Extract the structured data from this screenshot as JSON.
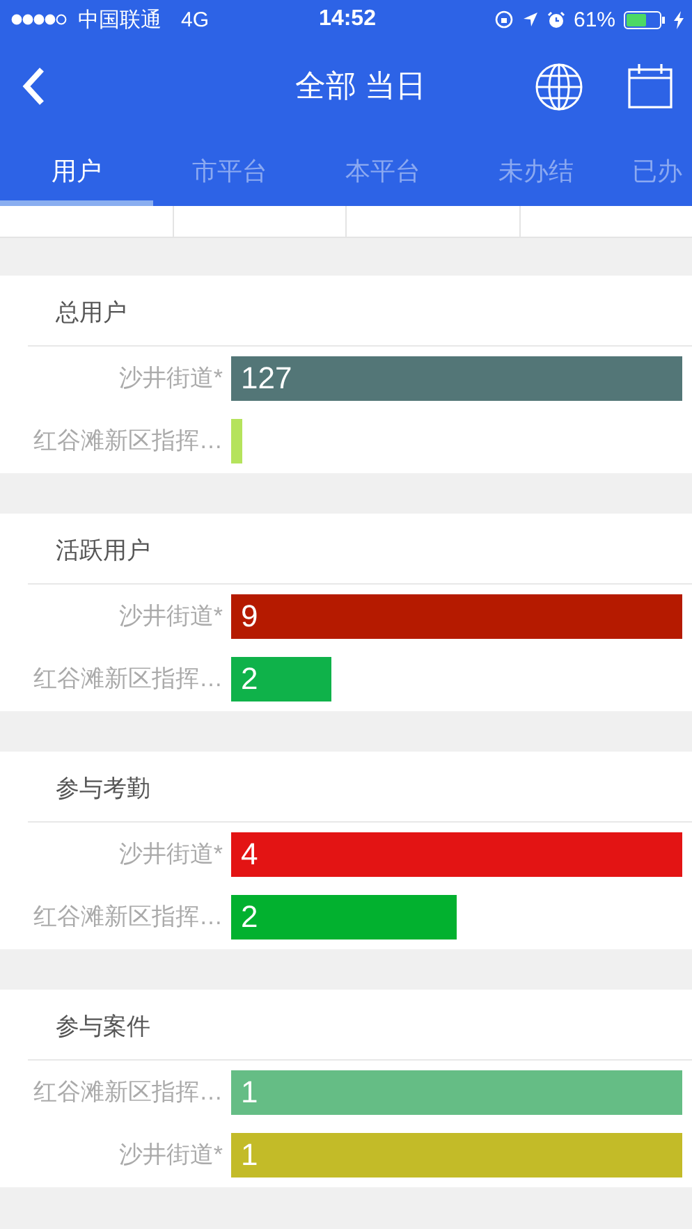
{
  "status_bar": {
    "carrier": "中国联通",
    "network": "4G",
    "time": "14:52",
    "battery": "61%",
    "charging": true
  },
  "header": {
    "title": "全部 当日"
  },
  "tabs": [
    {
      "label": "用户",
      "selected": true
    },
    {
      "label": "市平台",
      "selected": false
    },
    {
      "label": "本平台",
      "selected": false
    },
    {
      "label": "未办结",
      "selected": false
    },
    {
      "label": "已办",
      "selected": false
    }
  ],
  "cards": [
    {
      "title": "总用户",
      "bars": [
        {
          "label": "沙井街道*",
          "value": "127",
          "color": "#537677"
        },
        {
          "label": "红谷滩新区指挥…",
          "color": "#b5e35c"
        }
      ]
    },
    {
      "title": "活跃用户",
      "bars": [
        {
          "label": "沙井街道*",
          "value": "9",
          "color": "#b51a00"
        },
        {
          "label": "红谷滩新区指挥…",
          "value": "2",
          "color": "#0fb24a"
        }
      ]
    },
    {
      "title": "参与考勤",
      "bars": [
        {
          "label": "沙井街道*",
          "value": "4",
          "color": "#e31414"
        },
        {
          "label": "红谷滩新区指挥…",
          "value": "2",
          "color": "#02b12f"
        }
      ]
    },
    {
      "title": "参与案件",
      "bars": [
        {
          "label": "红谷滩新区指挥…",
          "value": "1",
          "color": "#65bd85"
        },
        {
          "label": "沙井街道*",
          "value": "1",
          "color": "#c3bb28"
        }
      ]
    }
  ]
}
